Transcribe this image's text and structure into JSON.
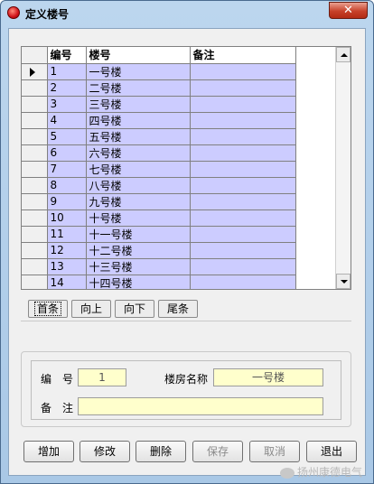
{
  "window": {
    "title": "定义楼号",
    "close_symbol": "✕"
  },
  "grid": {
    "columns": [
      "编号",
      "楼号",
      "备注"
    ],
    "rows": [
      {
        "num": "1",
        "name": "一号楼",
        "note": ""
      },
      {
        "num": "2",
        "name": "二号楼",
        "note": ""
      },
      {
        "num": "3",
        "name": "三号楼",
        "note": ""
      },
      {
        "num": "4",
        "name": "四号楼",
        "note": ""
      },
      {
        "num": "5",
        "name": "五号楼",
        "note": ""
      },
      {
        "num": "6",
        "name": "六号楼",
        "note": ""
      },
      {
        "num": "7",
        "name": "七号楼",
        "note": ""
      },
      {
        "num": "8",
        "name": "八号楼",
        "note": ""
      },
      {
        "num": "9",
        "name": "九号楼",
        "note": ""
      },
      {
        "num": "10",
        "name": "十号楼",
        "note": ""
      },
      {
        "num": "11",
        "name": "十一号楼",
        "note": ""
      },
      {
        "num": "12",
        "name": "十二号楼",
        "note": ""
      },
      {
        "num": "13",
        "name": "十三号楼",
        "note": ""
      },
      {
        "num": "14",
        "name": "十四号楼",
        "note": ""
      }
    ],
    "current_row": 0,
    "cell_color": "#ccccff"
  },
  "nav": {
    "first": "首条",
    "prev": "向上",
    "next": "向下",
    "last": "尾条"
  },
  "form": {
    "num_label": "编　号",
    "num_value": "1",
    "name_label": "楼房名称",
    "name_value": "一号楼",
    "note_label": "备　注",
    "note_value": "",
    "field_color": "#ffffcc"
  },
  "buttons": {
    "add": "增加",
    "edit": "修改",
    "delete": "删除",
    "save": "保存",
    "cancel": "取消",
    "exit": "退出"
  },
  "watermark": "扬州康德电气"
}
